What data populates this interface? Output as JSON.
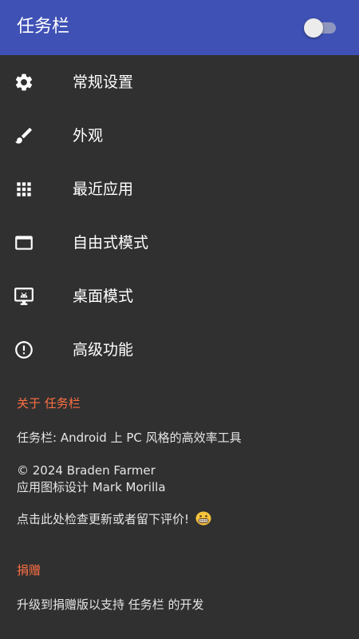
{
  "app_bar": {
    "title": "任务栏",
    "toggle_on": false
  },
  "colors": {
    "app_bar": "#3F51B5",
    "background": "#303030",
    "accent": "#FF7043",
    "text": "#FFFFFF"
  },
  "menu": [
    {
      "icon": "gear-icon",
      "label": "常规设置"
    },
    {
      "icon": "brush-icon",
      "label": "外观"
    },
    {
      "icon": "grid-icon",
      "label": "最近应用"
    },
    {
      "icon": "window-icon",
      "label": "自由式模式"
    },
    {
      "icon": "desktop-monitor-icon",
      "label": "桌面模式"
    },
    {
      "icon": "alert-circle-icon",
      "label": "高级功能"
    }
  ],
  "about": {
    "header": "关于 任务栏",
    "description": "任务栏: Android 上 PC 风格的高效率工具",
    "copyright": "© 2024 Braden Farmer",
    "icon_credit": "应用图标设计 Mark Morilla",
    "update_prompt": "点击此处检查更新或者留下评价!",
    "update_emoji": "grinning-face-icon"
  },
  "donate": {
    "header": "捐赠",
    "text": "升级到捐赠版以支持 任务栏 的开发"
  }
}
